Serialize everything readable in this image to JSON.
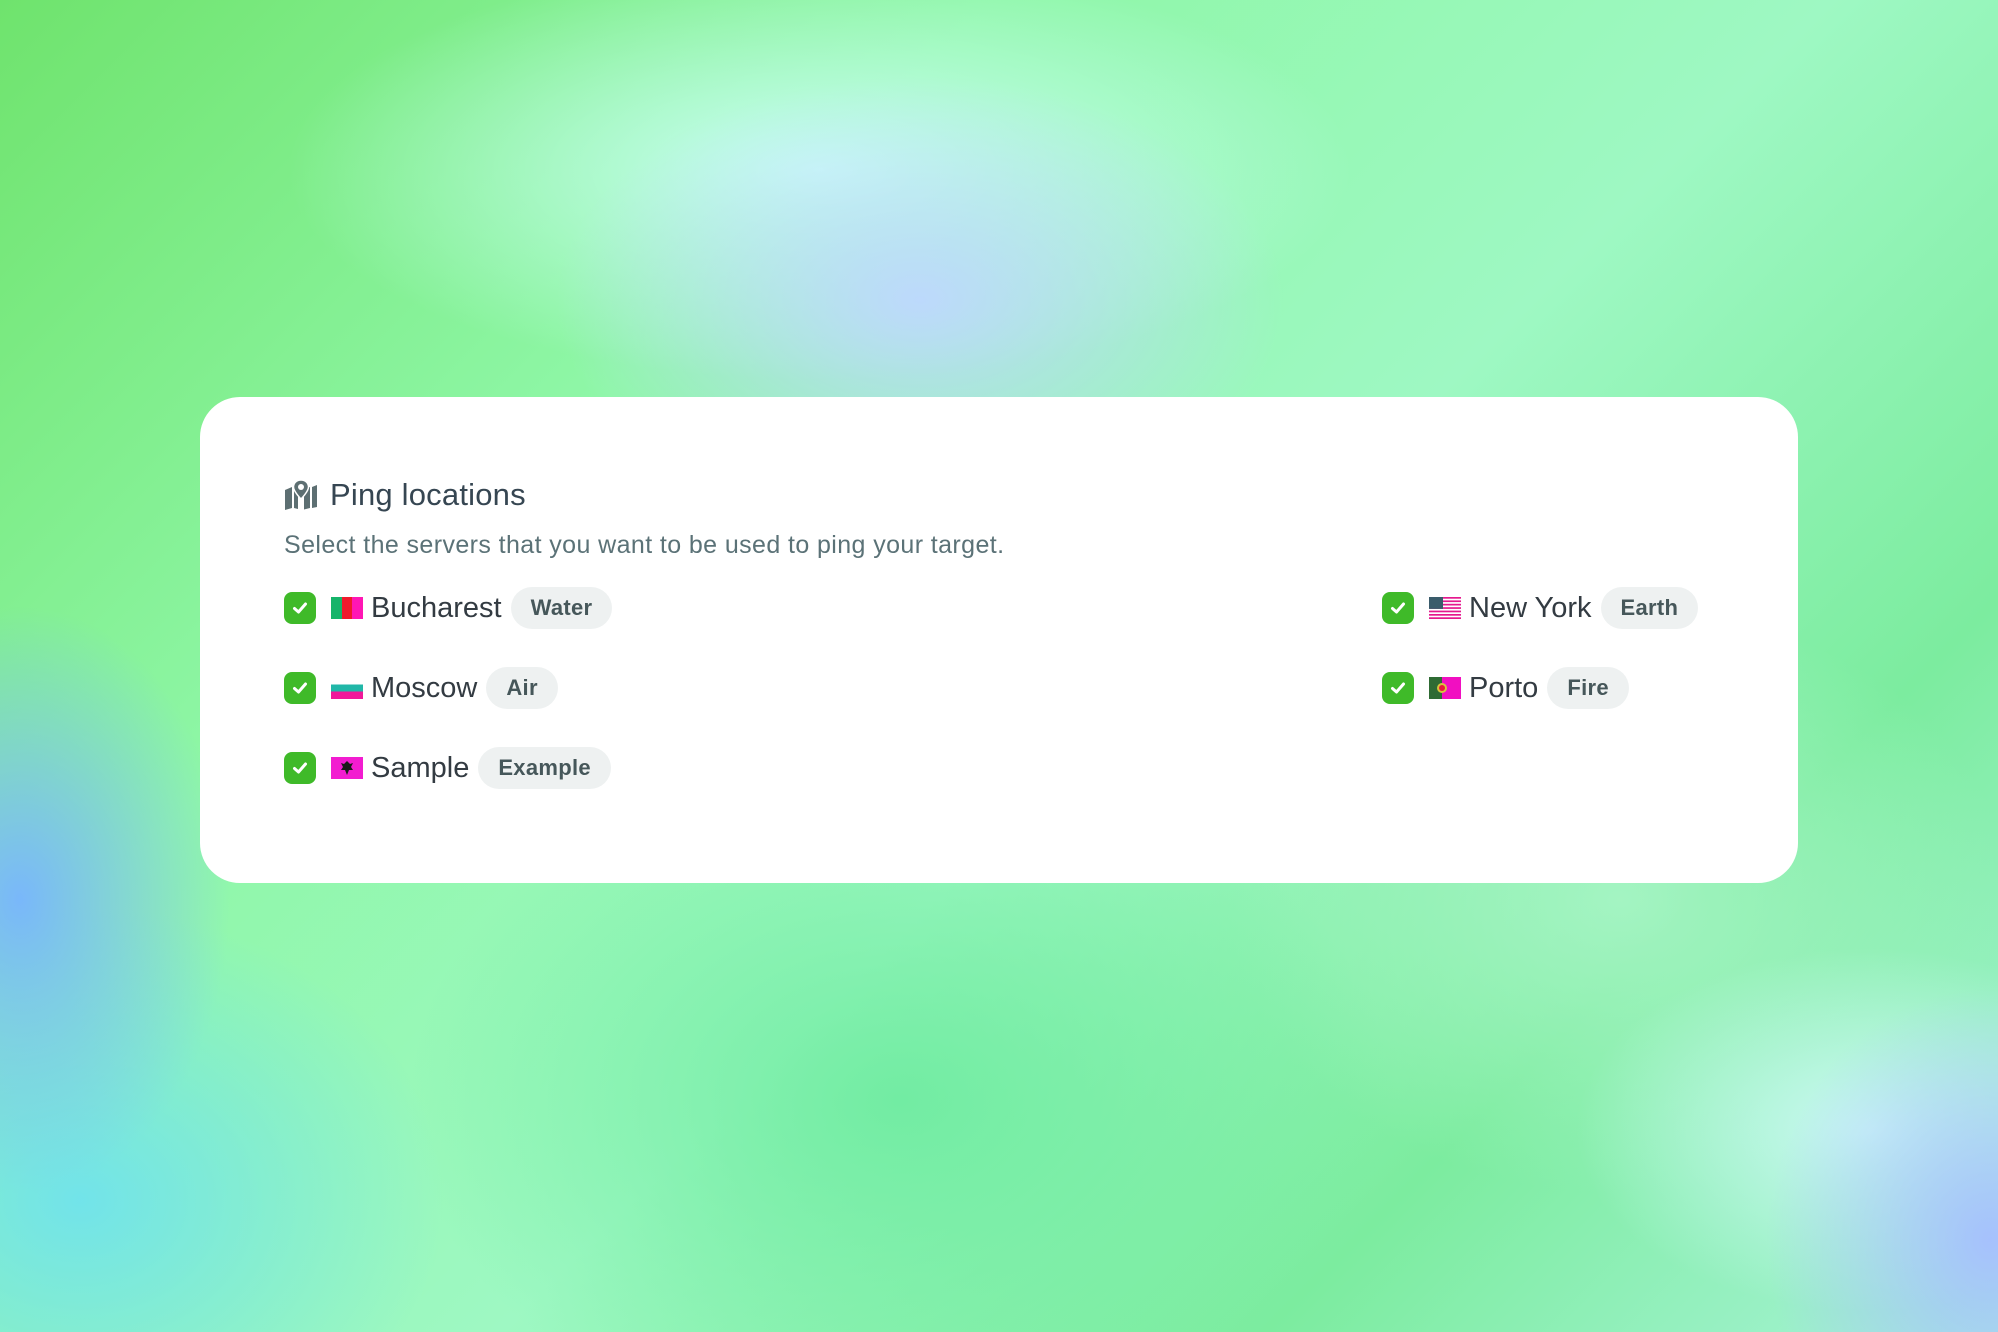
{
  "panel": {
    "title": "Ping locations",
    "title_icon": "map-pin-icon",
    "subtitle": "Select the servers that you want to be used to ping your target."
  },
  "locations": [
    {
      "city": "Bucharest",
      "tag": "Water",
      "flag_icon": "romania-flag-icon",
      "checked": true
    },
    {
      "city": "Moscow",
      "tag": "Air",
      "flag_icon": "russia-flag-icon",
      "checked": true
    },
    {
      "city": "Sample",
      "tag": "Example",
      "flag_icon": "albania-flag-icon",
      "checked": true
    },
    {
      "city": "New York",
      "tag": "Earth",
      "flag_icon": "usa-flag-icon",
      "checked": true
    },
    {
      "city": "Porto",
      "tag": "Fire",
      "flag_icon": "portugal-flag-icon",
      "checked": true
    }
  ],
  "colors": {
    "check_accent": "#3fba29",
    "badge_background": "#eef1f1"
  }
}
